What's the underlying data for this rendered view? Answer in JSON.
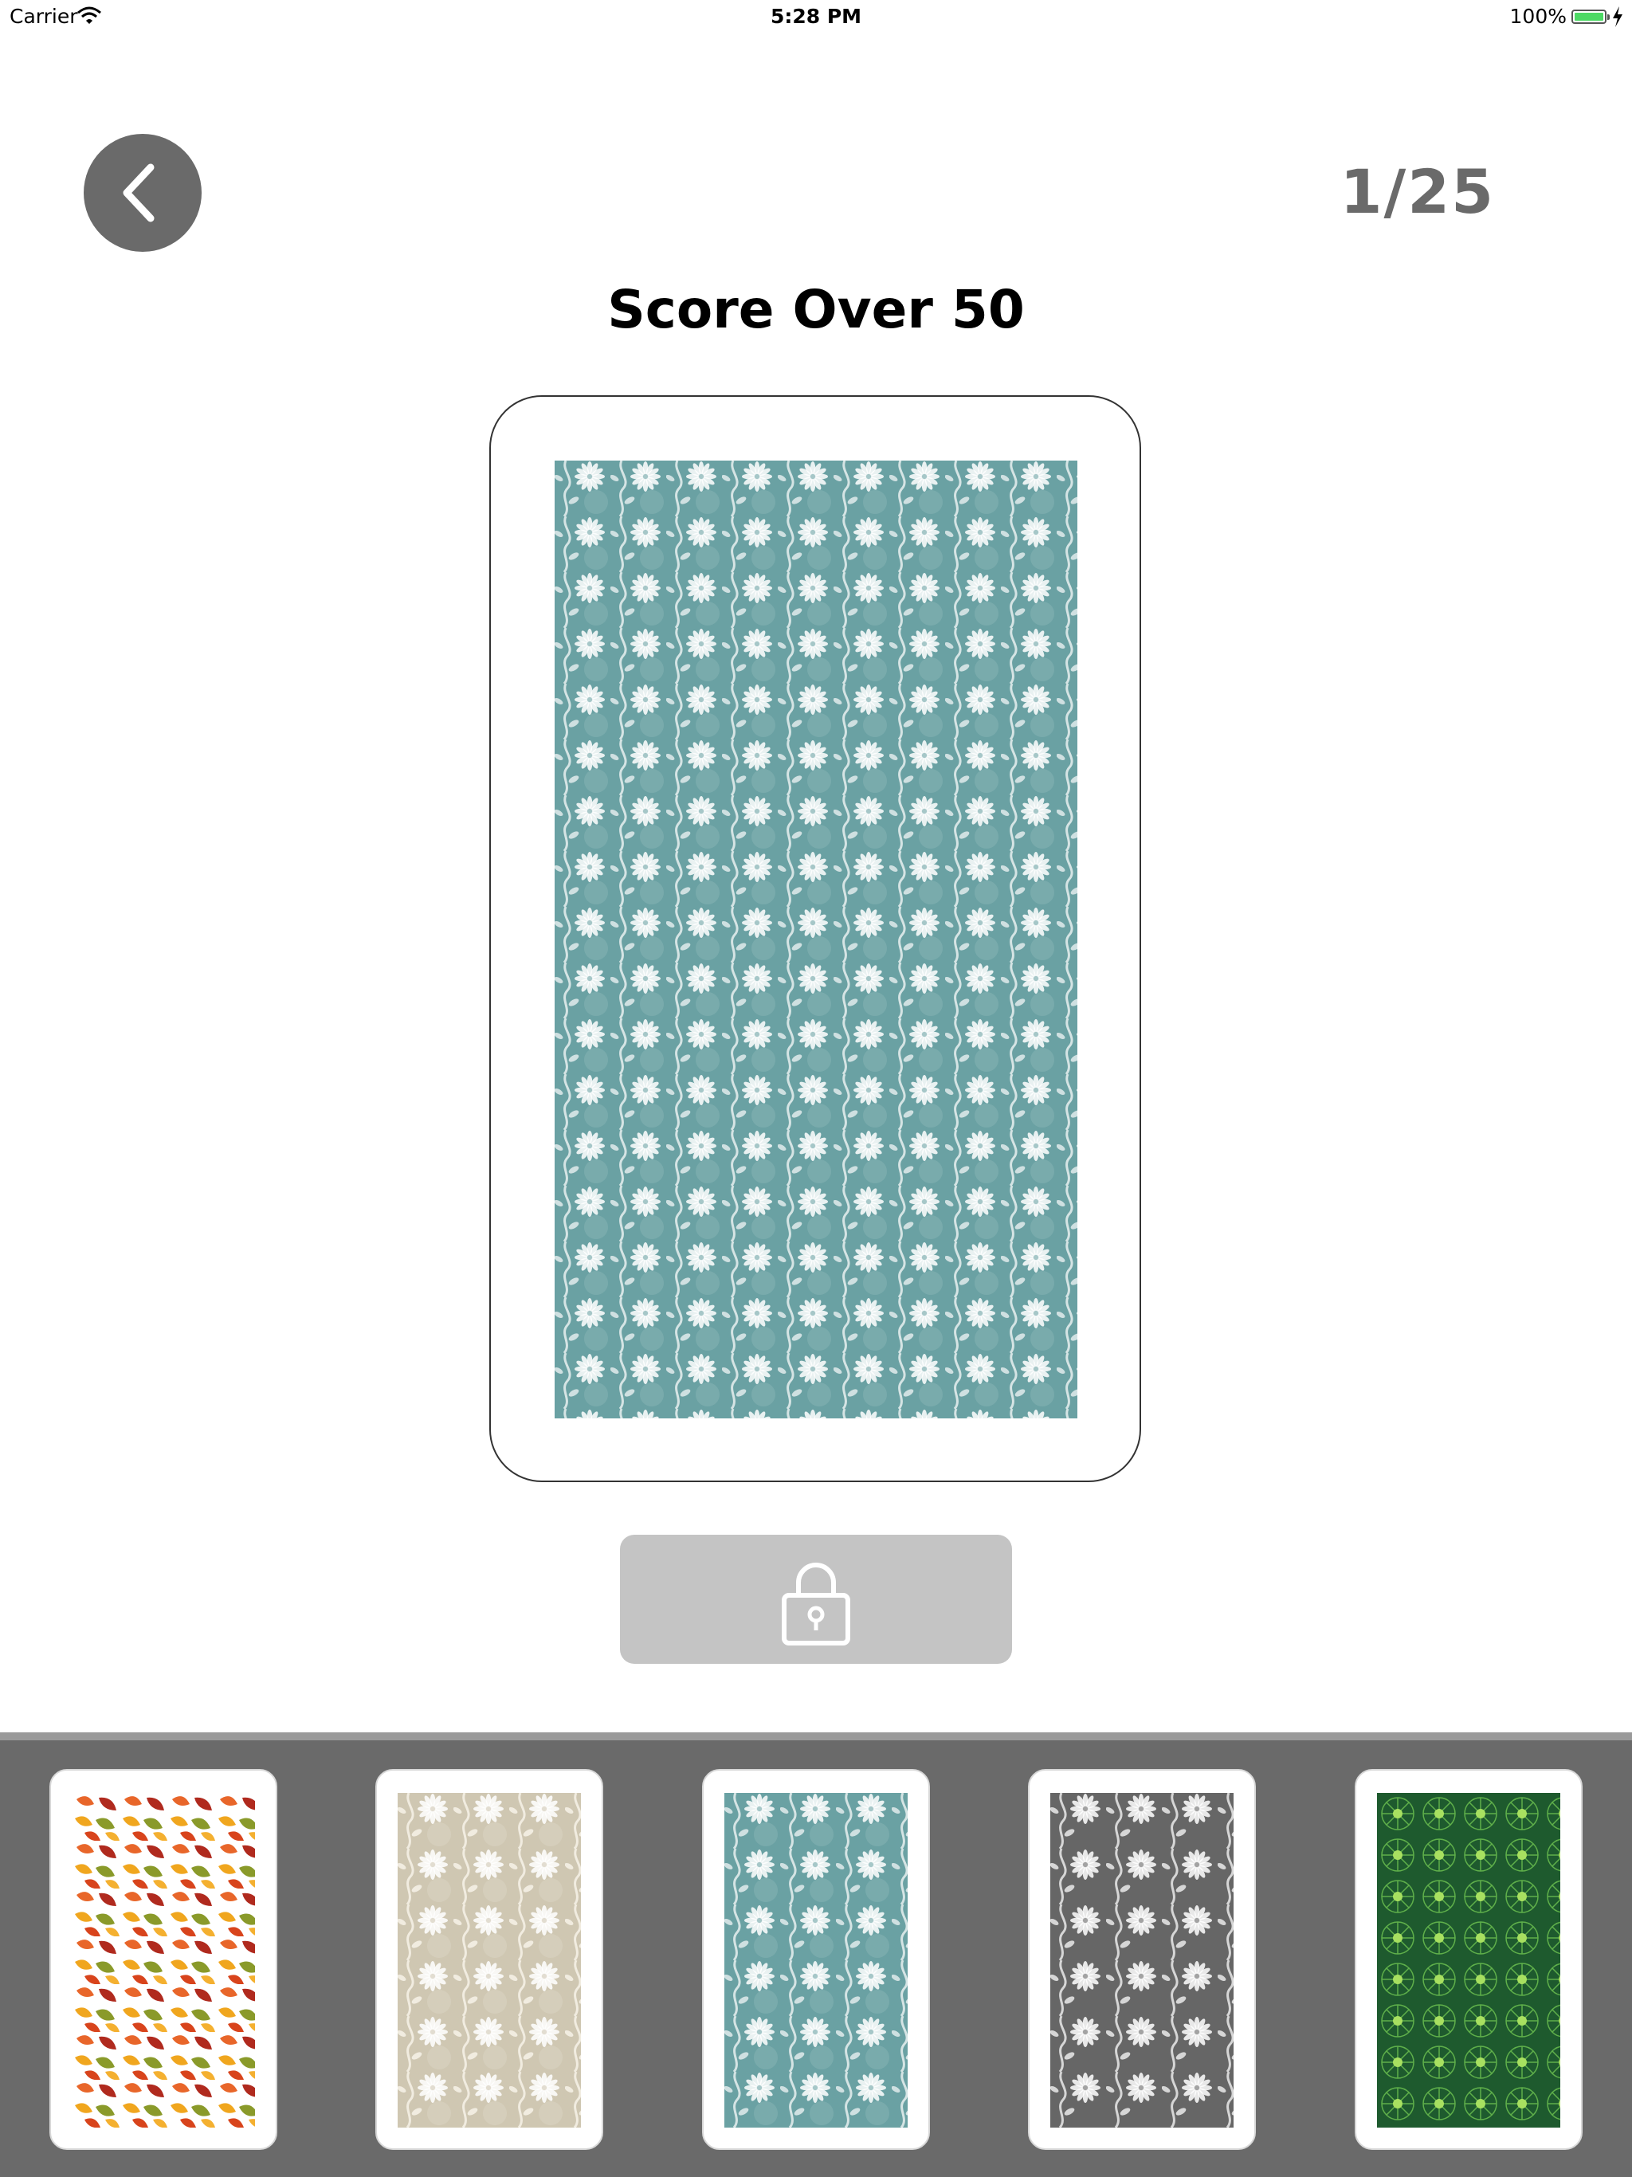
{
  "status_bar": {
    "carrier": "Carrier",
    "time": "5:28 PM",
    "battery": "100%",
    "battery_color": "#4cd964"
  },
  "header": {
    "back_icon": "chevron-left-icon",
    "counter": "1/25",
    "title": "Score Over 50"
  },
  "selected_card": {
    "pattern": "teal-daisy-vine",
    "background": "#6aa1a3"
  },
  "unlock_button": {
    "icon": "lock-icon",
    "state": "locked",
    "color": "#c4c4c4"
  },
  "thumbnails": [
    {
      "pattern": "autumn-leaves",
      "background": "#ffffff"
    },
    {
      "pattern": "beige-daisy-vine",
      "background": "#cfc7b2"
    },
    {
      "pattern": "teal-daisy-vine",
      "background": "#6aa1a3"
    },
    {
      "pattern": "gray-daisy-vine",
      "background": "#666666"
    },
    {
      "pattern": "green-pinwheel",
      "background": "#1e5a2e"
    }
  ],
  "colors": {
    "accent_gray": "#6a6a6a",
    "strip_background": "#6a6a6a"
  }
}
